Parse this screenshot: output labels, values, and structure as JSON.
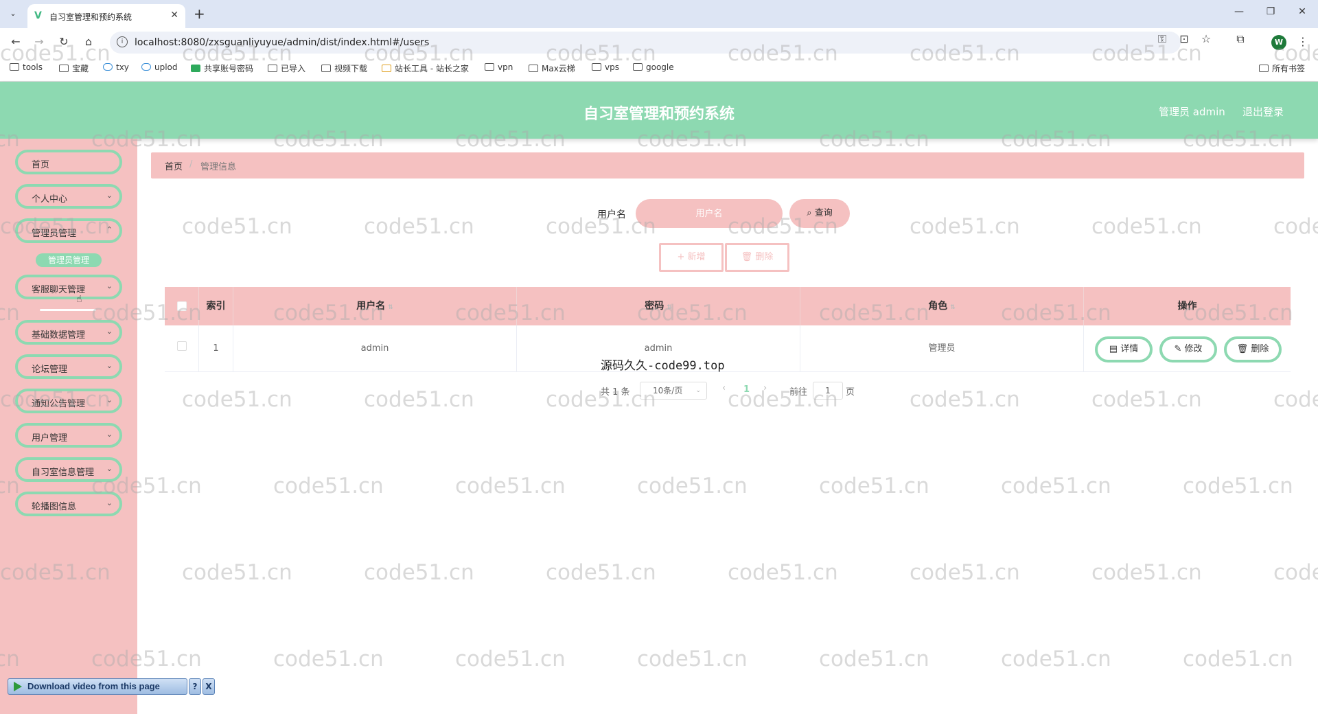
{
  "browser": {
    "tab_title": "自习室管理和预约系统",
    "url": "localhost:8080/zxsguanliyuyue/admin/dist/index.html#/users",
    "profile_initial": "W",
    "bookmarks": [
      "tools",
      "宝藏",
      "txy",
      "uplod",
      "共享账号密码",
      "已导入",
      "视频下载",
      "站长工具 - 站长之家",
      "vpn",
      "Max云梯",
      "vps",
      "google"
    ],
    "all_bookmarks": "所有书签"
  },
  "header": {
    "title": "自习室管理和预约系统",
    "user": "管理员 admin",
    "logout": "退出登录"
  },
  "sidebar": {
    "items": [
      {
        "label": "首页"
      },
      {
        "label": "个人中心"
      },
      {
        "label": "管理员管理"
      },
      {
        "label": "客服聊天管理"
      },
      {
        "label": "基础数据管理"
      },
      {
        "label": "论坛管理"
      },
      {
        "label": "通知公告管理"
      },
      {
        "label": "用户管理"
      },
      {
        "label": "自习室信息管理"
      },
      {
        "label": "轮播图信息"
      }
    ],
    "submenu_active": "管理员管理"
  },
  "breadcrumb": {
    "home": "首页",
    "separator": "/",
    "current": "管理信息"
  },
  "search": {
    "label": "用户名",
    "placeholder": "用户名",
    "button": "查询"
  },
  "actions": {
    "add": "新增",
    "delete": "删除"
  },
  "table": {
    "columns": [
      "索引",
      "用户名",
      "密码",
      "角色",
      "操作"
    ],
    "rows": [
      {
        "index": "1",
        "username": "admin",
        "password": "admin",
        "role": "管理员"
      }
    ],
    "row_actions": {
      "detail": "详情",
      "edit": "修改",
      "delete": "删除"
    }
  },
  "overlay_text": "源码久久-code99.top",
  "pagination": {
    "total": "共 1 条",
    "page_size": "10条/页",
    "current_page": "1",
    "goto_label": "前往",
    "goto_value": "1",
    "page_suffix": "页"
  },
  "extension": {
    "download_label": "Download video from this page",
    "help": "?",
    "close": "X"
  },
  "watermark": "code51.cn",
  "colors": {
    "header_green": "#8dd9b1",
    "pink": "#f5c1c1"
  }
}
